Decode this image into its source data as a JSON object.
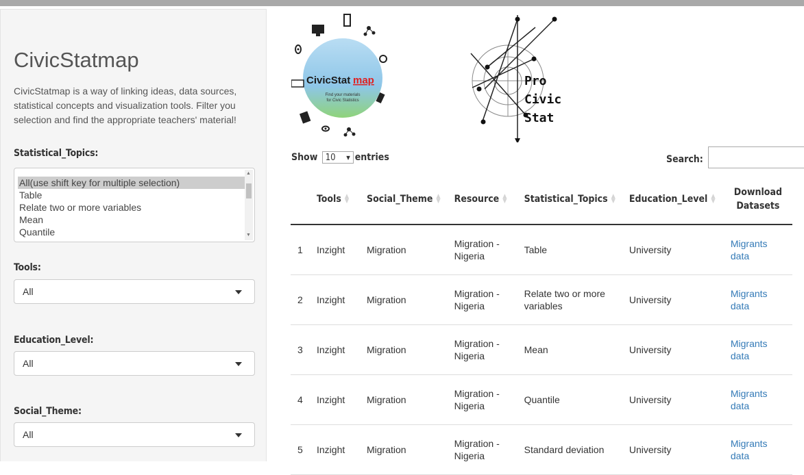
{
  "app": {
    "title": "CivicStatmap",
    "description": "CivicStatmap is a way of linking ideas, data sources, statistical concepts and visualization tools. Filter you selection and find the appropriate teachers' material!"
  },
  "filters": {
    "statistical_topics": {
      "label": "Statistical_Topics:",
      "options": [
        "All(use shift key for multiple selection)",
        "Table",
        "Relate two or more variables",
        "Mean",
        "Quantile"
      ],
      "selected": "All(use shift key for multiple selection)"
    },
    "tools": {
      "label": "Tools:",
      "value": "All"
    },
    "education_level": {
      "label": "Education_Level:",
      "value": "All"
    },
    "social_theme": {
      "label": "Social_Theme:",
      "value": "All"
    }
  },
  "logos": {
    "civicstatmap": {
      "name_a": "CivicStat",
      "name_b": "map",
      "tagline1": "Find your materials",
      "tagline2": "for Civic Statistics"
    },
    "procivicstat": {
      "line1": "Pro",
      "line2": "Civic",
      "line3": "Stat"
    }
  },
  "table_controls": {
    "show": "Show",
    "entries_value": "10",
    "entries": "entries",
    "search_label": "Search:",
    "search_value": ""
  },
  "table": {
    "headers": [
      "",
      "Tools",
      "Social_Theme",
      "Resource",
      "Statistical_Topics",
      "Education_Level",
      "Download Datasets"
    ],
    "rows": [
      [
        "1",
        "Inzight",
        "Migration",
        "Migration - Nigeria",
        "Table",
        "University",
        "Migrants data"
      ],
      [
        "2",
        "Inzight",
        "Migration",
        "Migration - Nigeria",
        "Relate two or more variables",
        "University",
        "Migrants data"
      ],
      [
        "3",
        "Inzight",
        "Migration",
        "Migration - Nigeria",
        "Mean",
        "University",
        "Migrants data"
      ],
      [
        "4",
        "Inzight",
        "Migration",
        "Migration - Nigeria",
        "Quantile",
        "University",
        "Migrants data"
      ],
      [
        "5",
        "Inzight",
        "Migration",
        "Migration - Nigeria",
        "Standard deviation",
        "University",
        "Migrants data"
      ]
    ]
  },
  "colors": {
    "link": "#337ab7",
    "sidebar_bg": "#f5f5f5",
    "selected_option": "#cdcdcd",
    "logo_circle": "#8ec6e8",
    "logo_accent": "#e02020"
  }
}
